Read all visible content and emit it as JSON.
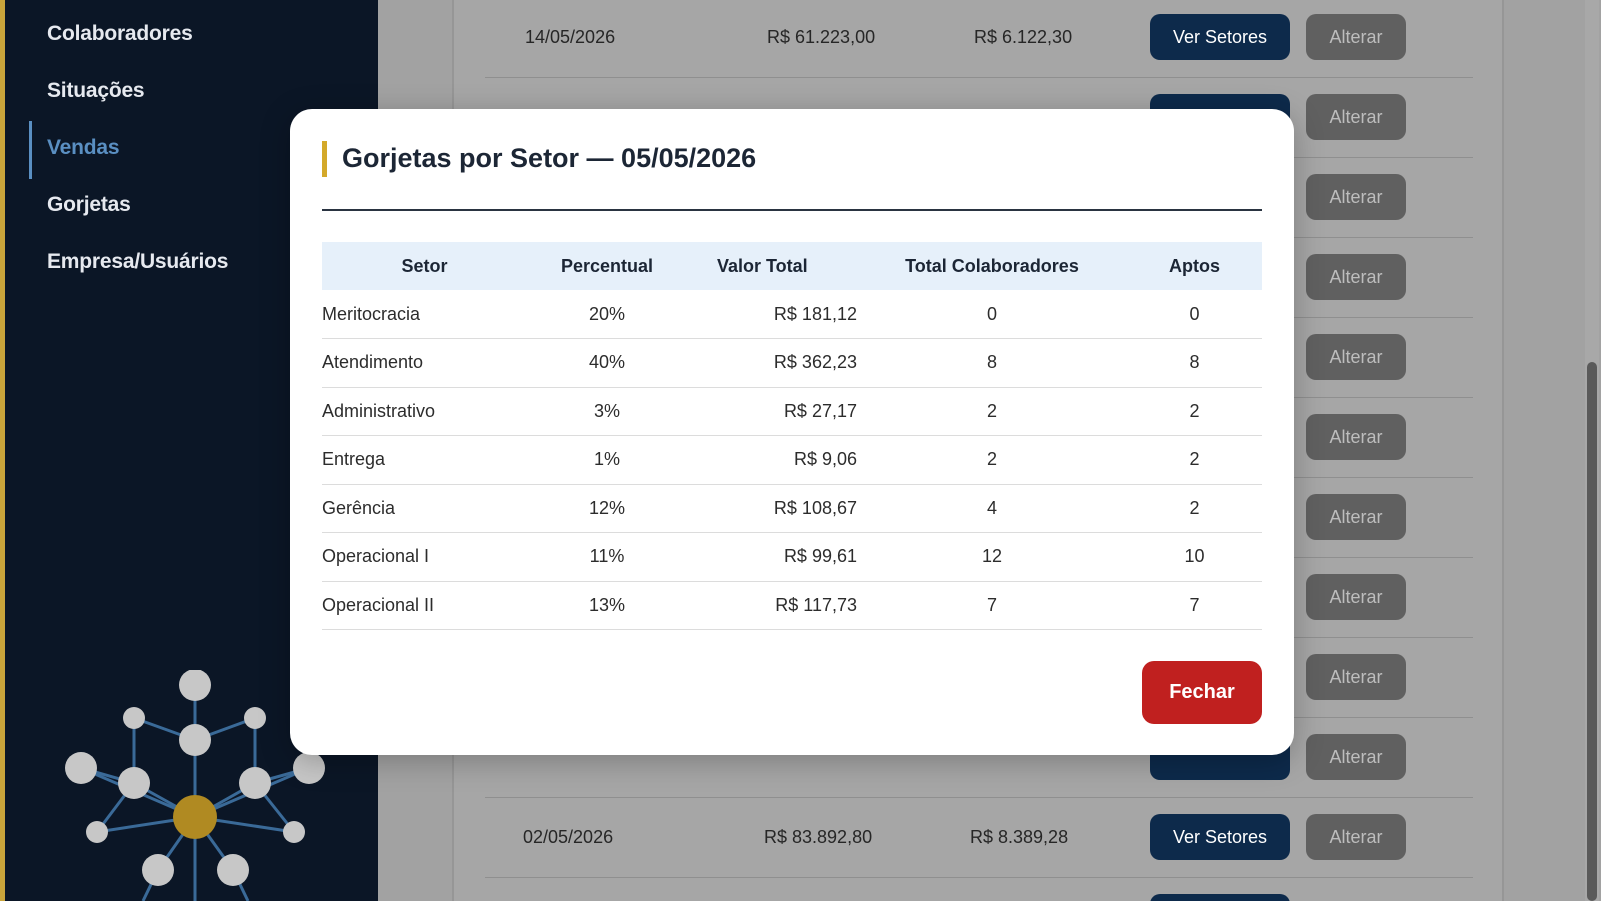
{
  "sidebar": {
    "items": [
      {
        "label": "Colaboradores"
      },
      {
        "label": "Situações"
      },
      {
        "label": "Vendas"
      },
      {
        "label": "Gorjetas"
      },
      {
        "label": "Empresa/Usuários"
      }
    ],
    "active_item": "Vendas",
    "accent_color": "#c9a43b"
  },
  "background_list": {
    "rows": [
      {
        "date": "14/05/2026",
        "total": "R$ 61.223,00",
        "tip": "R$ 6.122,30",
        "ver_label": "Ver Setores",
        "alterar_label": "Alterar"
      },
      {
        "alterar_label": "Alterar"
      },
      {
        "alterar_label": "Alterar"
      },
      {
        "alterar_label": "Alterar"
      },
      {
        "alterar_label": "Alterar"
      },
      {
        "alterar_label": "Alterar"
      },
      {
        "alterar_label": "Alterar"
      },
      {
        "alterar_label": "Alterar"
      },
      {
        "alterar_label": "Alterar"
      },
      {
        "alterar_label": "Alterar"
      },
      {
        "date": "02/05/2026",
        "total": "R$ 83.892,80",
        "tip": "R$ 8.389,28",
        "ver_label": "Ver Setores",
        "alterar_label": "Alterar"
      }
    ]
  },
  "modal": {
    "title": "Gorjetas por Setor — 05/05/2026",
    "columns": [
      "Setor",
      "Percentual",
      "Valor Total",
      "Total Colaboradores",
      "Aptos"
    ],
    "rows": [
      {
        "setor": "Meritocracia",
        "percentual": "20%",
        "valor": "R$ 181,12",
        "total": "0",
        "aptos": "0"
      },
      {
        "setor": "Atendimento",
        "percentual": "40%",
        "valor": "R$ 362,23",
        "total": "8",
        "aptos": "8"
      },
      {
        "setor": "Administrativo",
        "percentual": "3%",
        "valor": "R$ 27,17",
        "total": "2",
        "aptos": "2"
      },
      {
        "setor": "Entrega",
        "percentual": "1%",
        "valor": "R$ 9,06",
        "total": "2",
        "aptos": "2"
      },
      {
        "setor": "Gerência",
        "percentual": "12%",
        "valor": "R$ 108,67",
        "total": "4",
        "aptos": "2"
      },
      {
        "setor": "Operacional I",
        "percentual": "11%",
        "valor": "R$ 99,61",
        "total": "12",
        "aptos": "10"
      },
      {
        "setor": "Operacional II",
        "percentual": "13%",
        "valor": "R$ 117,73",
        "total": "7",
        "aptos": "7"
      }
    ],
    "close_label": "Fechar",
    "close_color": "#c0201f",
    "title_accent_color": "#d4a92a"
  }
}
